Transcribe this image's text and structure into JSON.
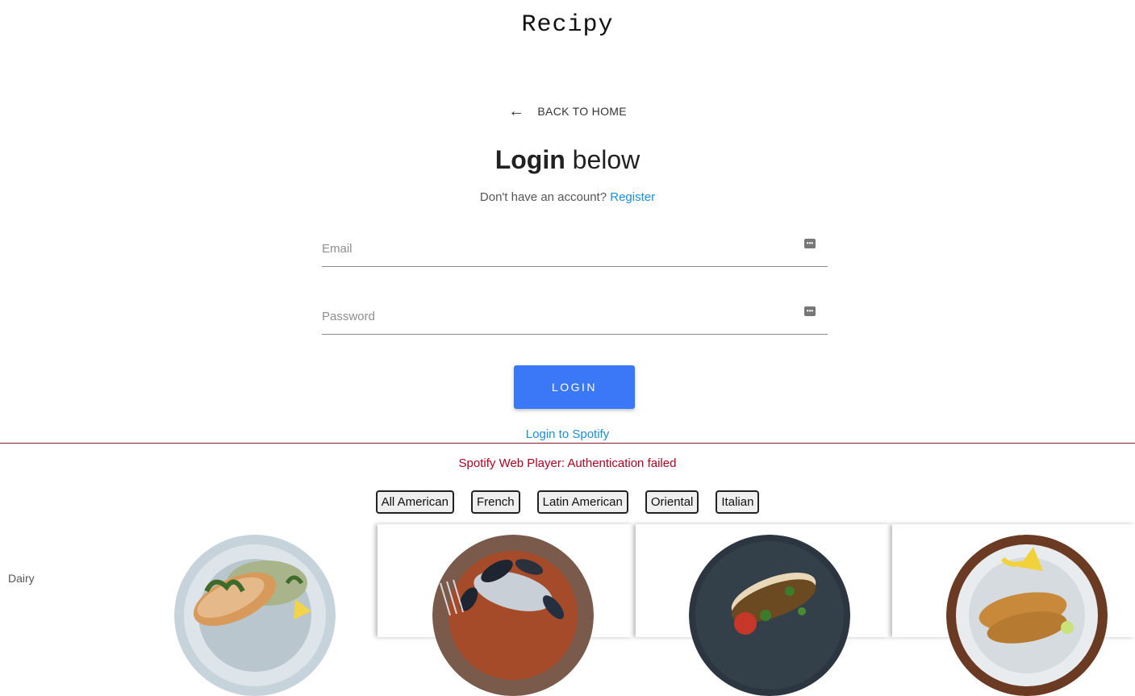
{
  "header": {
    "logo": "Recipy"
  },
  "nav": {
    "back_label": "BACK TO HOME",
    "back_icon": "arrow-left-icon"
  },
  "login": {
    "title_bold": "Login",
    "title_rest": " below",
    "no_account_text": "Don't have an account?",
    "register_link": "Register",
    "email_placeholder": "Email",
    "email_value": "",
    "password_placeholder": "Password",
    "password_value": "",
    "autofill_icon": "password-manager-icon",
    "login_button": "LOGIN",
    "spotify_link": "Login to Spotify"
  },
  "spotify": {
    "error_text": "Spotify Web Player: Authentication failed"
  },
  "cuisines": [
    "All American",
    "French",
    "Latin American",
    "Oriental",
    "Italian"
  ],
  "category": {
    "label": "Dairy"
  },
  "recipes": [
    {
      "image": "fish-with-greens-plate"
    },
    {
      "image": "seafood-stew-plate"
    },
    {
      "image": "fish-with-tomato-plate"
    },
    {
      "image": "fish-with-lemon-plate"
    }
  ],
  "colors": {
    "primary_button": "#3a78f7",
    "link": "#1a8fd8",
    "error": "#b00020",
    "divider": "#8b1a2a"
  }
}
